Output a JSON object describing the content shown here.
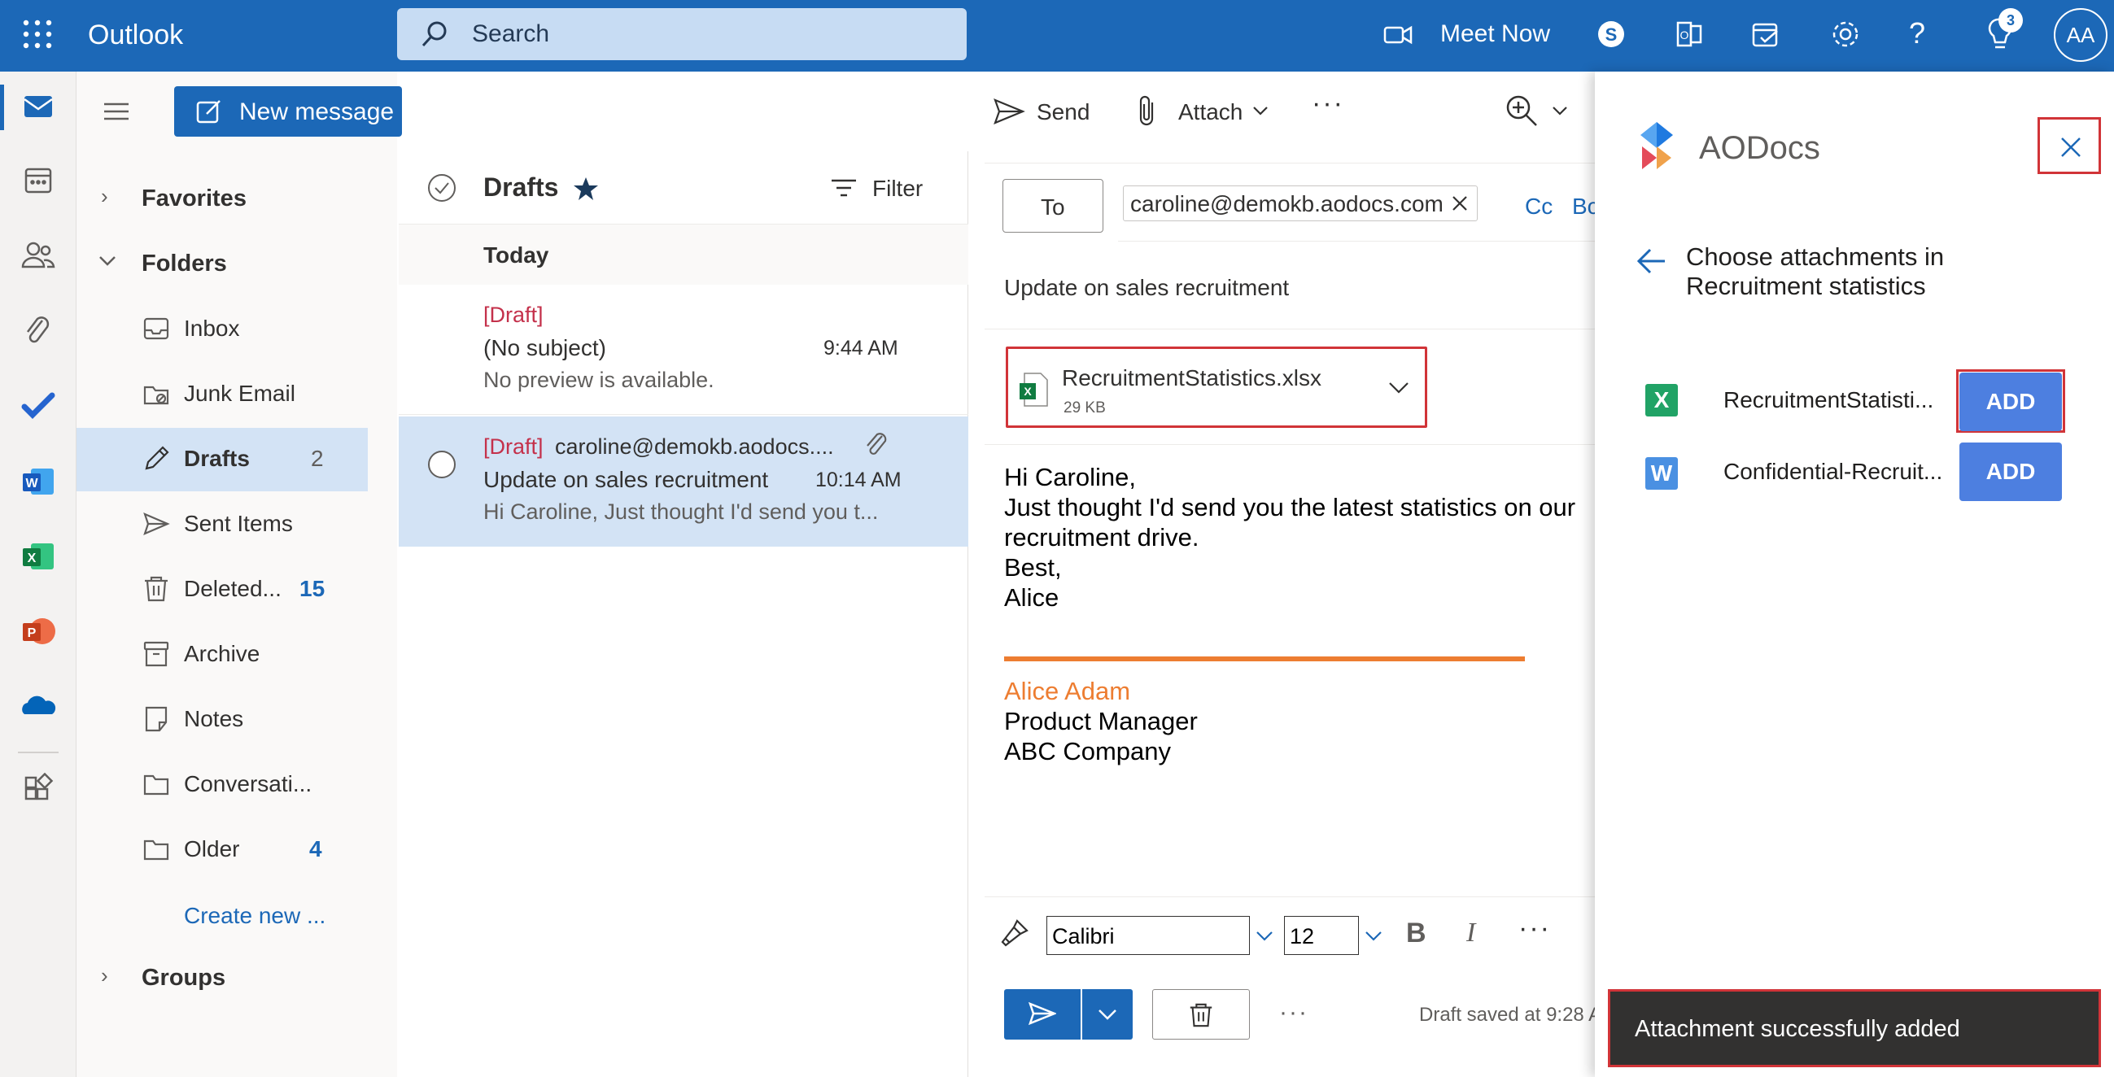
{
  "topbar": {
    "app_name": "Outlook",
    "search_placeholder": "Search",
    "meet_now": "Meet Now",
    "notifications_count": "3",
    "avatar_initials": "AA"
  },
  "folders": {
    "new_message": "New message",
    "favorites": "Favorites",
    "folders": "Folders",
    "items": [
      {
        "label": "Inbox",
        "count": ""
      },
      {
        "label": "Junk Email",
        "count": ""
      },
      {
        "label": "Drafts",
        "count": "2"
      },
      {
        "label": "Sent Items",
        "count": ""
      },
      {
        "label": "Deleted...",
        "count": "15"
      },
      {
        "label": "Archive",
        "count": ""
      },
      {
        "label": "Notes",
        "count": ""
      },
      {
        "label": "Conversati...",
        "count": ""
      },
      {
        "label": "Older",
        "count": "4"
      }
    ],
    "create_new": "Create new ...",
    "groups": "Groups"
  },
  "list": {
    "title": "Drafts",
    "filter": "Filter",
    "group_today": "Today",
    "messages": [
      {
        "tag": "[Draft]",
        "from": "",
        "subject": "(No subject)",
        "time": "9:44 AM",
        "preview": "No preview is available."
      },
      {
        "tag": "[Draft]",
        "from": "caroline@demokb.aodocs....",
        "subject": "Update on sales recruitment",
        "time": "10:14 AM",
        "preview": "Hi Caroline, Just thought I'd send you t..."
      }
    ]
  },
  "compose": {
    "send": "Send",
    "attach": "Attach",
    "to_label": "To",
    "recipient": "caroline@demokb.aodocs.com",
    "cc": "Cc",
    "bcc": "Bc",
    "subject": "Update on sales recruitment",
    "attachment_name": "RecruitmentStatistics.xlsx",
    "attachment_size": "29 KB",
    "body_lines": [
      "Hi Caroline,",
      "Just thought I'd send you the latest statistics on our",
      "recruitment drive.",
      "Best,",
      "Alice"
    ],
    "signature_name": "Alice Adam",
    "signature_title": "Product Manager",
    "signature_company": "ABC Company",
    "font_name": "Calibri",
    "font_size": "12",
    "draft_status": "Draft saved at 9:28 A"
  },
  "addin": {
    "brand": "AODocs",
    "heading_line1": "Choose attachments in",
    "heading_line2": "Recruitment statistics",
    "files": [
      {
        "icon_letter": "X",
        "name": "RecruitmentStatisti...",
        "button": "ADD"
      },
      {
        "icon_letter": "W",
        "name": "Confidential-Recruit...",
        "button": "ADD"
      }
    ],
    "toast": "Attachment successfully added"
  },
  "colors": {
    "brand_blue": "#1c68b7",
    "draft_red": "#c4314b",
    "signature_orange": "#ed7d31",
    "add_button": "#4d7fe0",
    "highlight_red": "#d13438"
  }
}
